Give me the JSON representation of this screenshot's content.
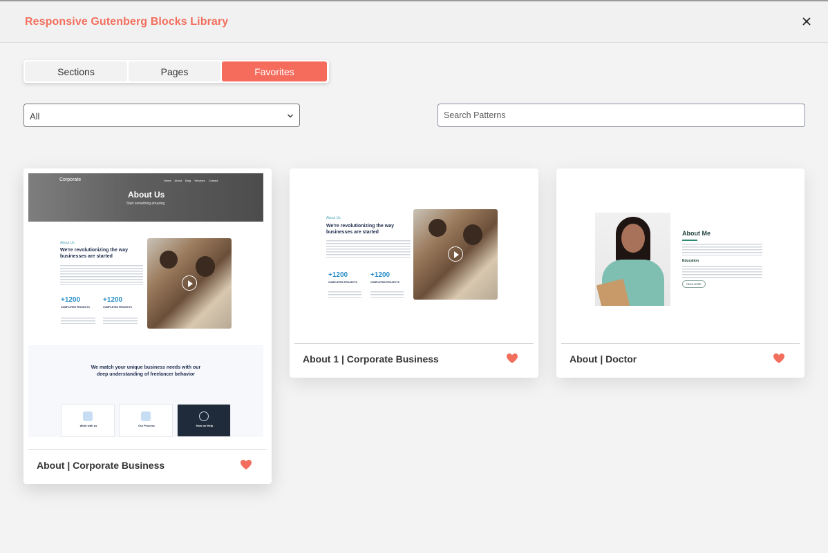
{
  "header": {
    "title": "Responsive Gutenberg Blocks Library",
    "close_label": "×"
  },
  "tabs": [
    {
      "label": "Sections",
      "active": false
    },
    {
      "label": "Pages",
      "active": false
    },
    {
      "label": "Favorites",
      "active": true
    }
  ],
  "filter": {
    "selected": "All"
  },
  "search": {
    "placeholder": "Search Patterns",
    "value": ""
  },
  "colors": {
    "accent": "#f56c5d",
    "heart": "#f26f5e",
    "title": "#f26f5e"
  },
  "cards": [
    {
      "name": "About | Corporate Business",
      "favorite": true,
      "preview": {
        "logo": "Corporate",
        "nav": "Home About Blog Services Contact",
        "hero_title": "About Us",
        "hero_subtitle": "Start something amazing",
        "tag": "About Us",
        "heading": "We're revolutionizing the way businesses are started",
        "stat1_value": "+1200",
        "stat1_caption": "COMPLETED PROJECTS",
        "stat2_value": "+1200",
        "stat2_caption": "COMPLETED PROJECTS",
        "band_heading": "We match your unique business needs with our deep understanding of freelancer behavior",
        "mini_cards": [
          "Work with us",
          "Our Process",
          "How we Help"
        ]
      }
    },
    {
      "name": "About 1 | Corporate Business",
      "favorite": true,
      "preview": {
        "tag": "About Us",
        "heading": "We're revolutionizing the way businesses are started",
        "stat1_value": "+1200",
        "stat1_caption": "COMPLETED PROJECTS",
        "stat2_value": "+1200",
        "stat2_caption": "COMPLETED PROJECTS"
      }
    },
    {
      "name": "About | Doctor",
      "favorite": true,
      "preview": {
        "heading": "About Me",
        "section": "Education",
        "button": "READ MORE"
      }
    }
  ]
}
